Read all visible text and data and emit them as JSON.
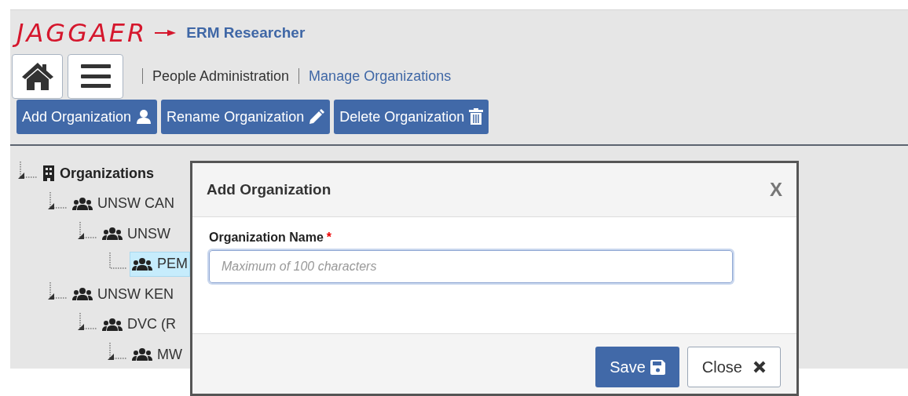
{
  "header": {
    "logo": "JAGGAER",
    "app_name": "ERM Researcher"
  },
  "breadcrumb": [
    {
      "label": "People Administration",
      "kind": "text"
    },
    {
      "label": "Manage Organizations",
      "kind": "link"
    }
  ],
  "toolbar": [
    {
      "label": "Add Organization",
      "kind": "add"
    },
    {
      "label": "Rename Organization",
      "kind": "rename"
    },
    {
      "label": "Delete Organization",
      "kind": "delete"
    }
  ],
  "tree": {
    "label": "Organizations",
    "expanded": true,
    "selected": false,
    "children": [
      {
        "label": "UNSW CAN",
        "expanded": true,
        "selected": false,
        "children": [
          {
            "label": "UNSW",
            "expanded": true,
            "selected": false,
            "children": [
              {
                "label": "PEM",
                "expanded": false,
                "selected": true
              }
            ]
          }
        ]
      },
      {
        "label": "UNSW KEN",
        "expanded": true,
        "selected": false,
        "children": [
          {
            "label": "DVC (R",
            "expanded": true,
            "selected": false,
            "children": [
              {
                "label": "MW",
                "expanded": true,
                "selected": false
              }
            ]
          }
        ]
      }
    ]
  },
  "dialog": {
    "title": "Add Organization",
    "close_glyph": "X",
    "field_label": "Organization Name",
    "required_mark": "*",
    "placeholder": "Maximum of 100 characters",
    "buttons": [
      {
        "label": "Save",
        "kind": "primary"
      },
      {
        "label": "Close",
        "kind": "secondary"
      }
    ]
  }
}
